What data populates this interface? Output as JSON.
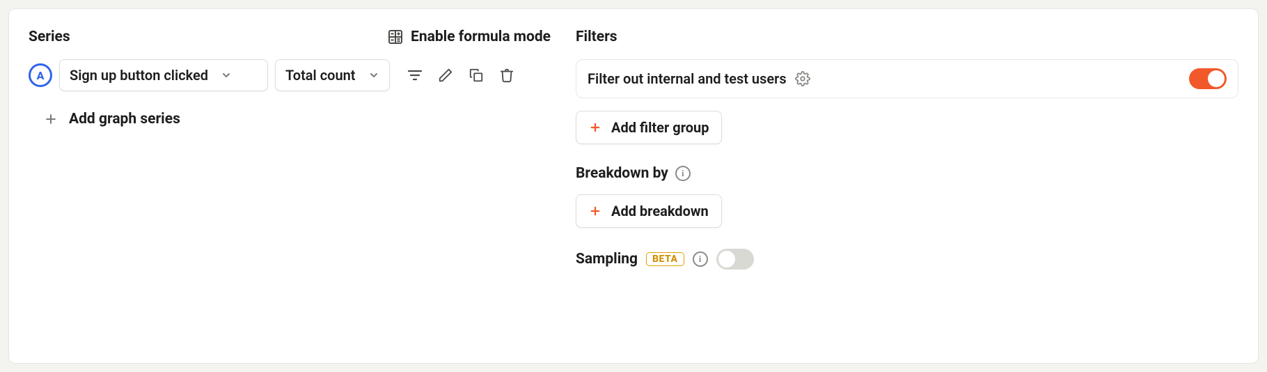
{
  "series": {
    "title": "Series",
    "formula_mode_label": "Enable formula mode",
    "items": [
      {
        "badge": "A",
        "event": "Sign up button clicked",
        "agg": "Total count"
      }
    ],
    "add_label": "Add graph series"
  },
  "filters": {
    "title": "Filters",
    "active_filter": "Filter out internal and test users",
    "active_filter_on": true,
    "add_group_label": "Add filter group"
  },
  "breakdown": {
    "title": "Breakdown by",
    "add_label": "Add breakdown"
  },
  "sampling": {
    "title": "Sampling",
    "badge": "BETA",
    "on": false
  }
}
